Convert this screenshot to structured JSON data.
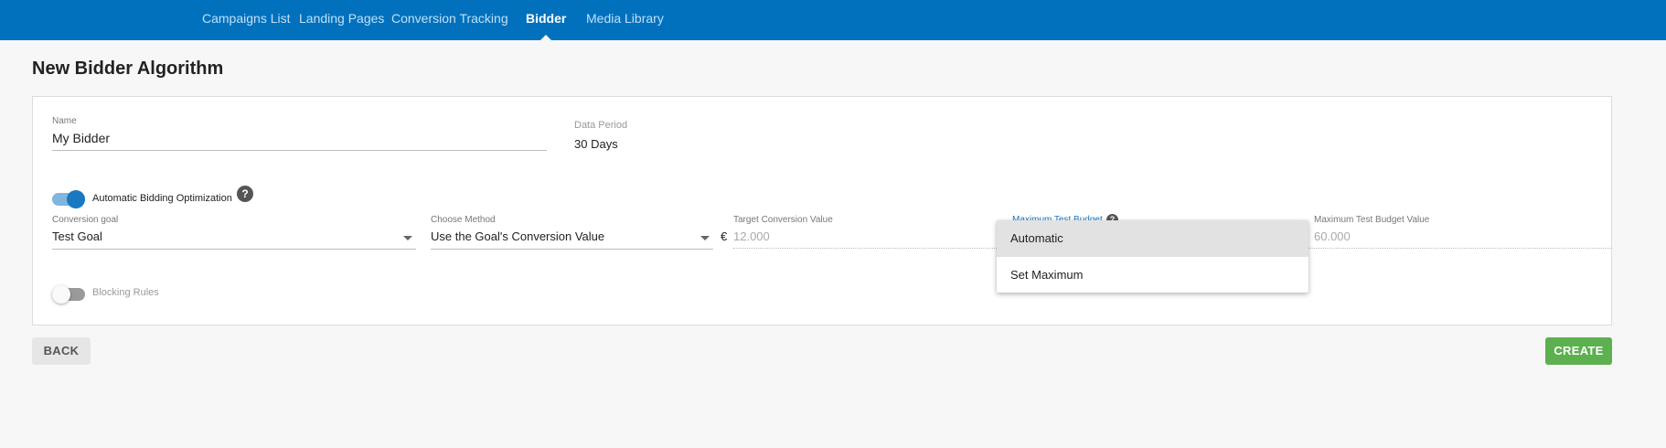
{
  "nav": {
    "items": [
      {
        "label": "Campaigns List",
        "active": false
      },
      {
        "label": "Landing Pages",
        "active": false
      },
      {
        "label": "Conversion Tracking",
        "active": false
      },
      {
        "label": "Bidder",
        "active": true
      },
      {
        "label": "Media Library",
        "active": false
      }
    ]
  },
  "page": {
    "title": "New Bidder Algorithm"
  },
  "form": {
    "name": {
      "label": "Name",
      "value": "My Bidder"
    },
    "data_period": {
      "label": "Data Period",
      "value": "30 Days"
    },
    "auto_bidding": {
      "label": "Automatic Bidding Optimization",
      "enabled": true,
      "help": "?"
    },
    "conversion_goal": {
      "label": "Conversion goal",
      "value": "Test Goal"
    },
    "choose_method": {
      "label": "Choose Method",
      "value": "Use the Goal's Conversion Value"
    },
    "target_conversion_value": {
      "label": "Target Conversion Value",
      "currency": "€",
      "placeholder": "12.000"
    },
    "max_test_budget": {
      "label": "Maximum Test Budget",
      "help": "?"
    },
    "max_test_budget_value": {
      "label": "Maximum Test Budget Value",
      "placeholder": "60.000"
    },
    "blocking_rules": {
      "label": "Blocking Rules",
      "enabled": false
    }
  },
  "dropdown": {
    "options": [
      {
        "label": "Automatic",
        "highlighted": true
      },
      {
        "label": "Set Maximum",
        "highlighted": false
      }
    ]
  },
  "buttons": {
    "back": "BACK",
    "create": "CREATE"
  },
  "colors": {
    "nav_bg": "#0171bd",
    "toggle_on": "#1a78c2",
    "create_bg": "#5cb04f",
    "label_active": "#1a78c2"
  }
}
